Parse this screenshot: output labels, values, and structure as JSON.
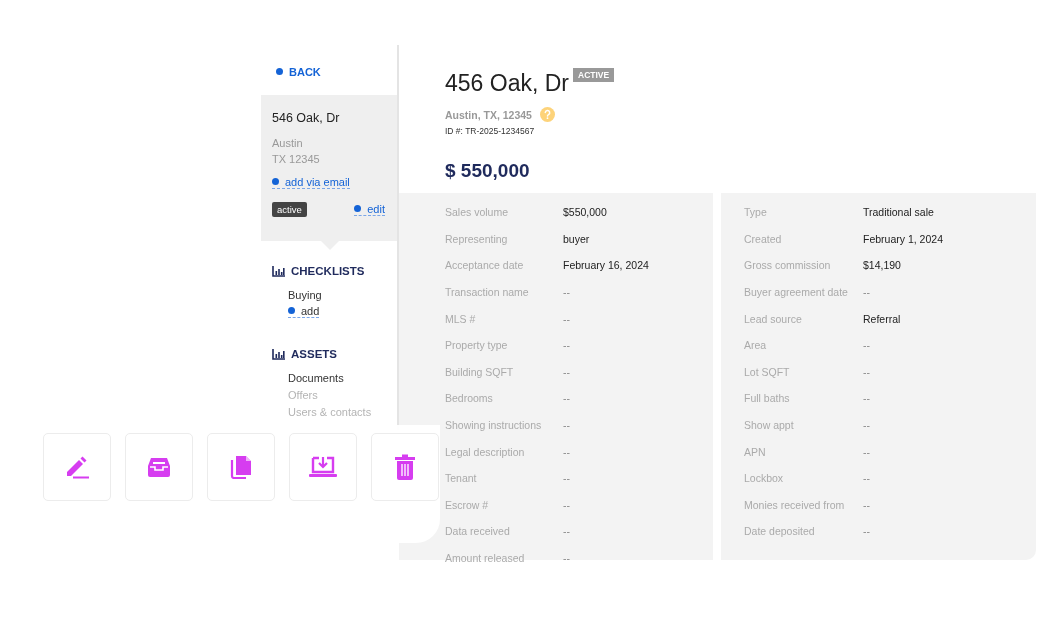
{
  "sidebar": {
    "back": "BACK",
    "card": {
      "title": "546 Oak, Dr",
      "city": "Austin",
      "state_zip": "TX 12345",
      "add_link": "add via email",
      "status": "active",
      "edit_link": "edit"
    },
    "sections": [
      {
        "heading": "CHECKLISTS",
        "items": [
          {
            "kind": "item",
            "label": "Buying",
            "dimmed": false
          },
          {
            "kind": "link",
            "label": "add",
            "dimmed": false
          }
        ]
      },
      {
        "heading": "ASSETS",
        "items": [
          {
            "kind": "item",
            "label": "Documents",
            "dimmed": false
          },
          {
            "kind": "item",
            "label": "Offers",
            "dimmed": true
          },
          {
            "kind": "item",
            "label": "Users & contacts",
            "dimmed": true
          }
        ]
      }
    ]
  },
  "header": {
    "title": "456 Oak, Dr",
    "status": "ACTIVE",
    "location": "Austin, TX, 12345",
    "id": "ID #: TR-2025-1234567",
    "price": "$ 550,000"
  },
  "details_left": [
    {
      "label": "Sales volume",
      "value": "$550,000",
      "muted": false
    },
    {
      "label": "Representing",
      "value": "buyer",
      "muted": false
    },
    {
      "label": "Acceptance date",
      "value": "February 16, 2024",
      "muted": false
    },
    {
      "label": "Transaction name",
      "value": "--",
      "muted": true
    },
    {
      "label": "MLS #",
      "value": "--",
      "muted": true
    },
    {
      "label": "Property type",
      "value": "--",
      "muted": true
    },
    {
      "label": "Building SQFT",
      "value": "--",
      "muted": true
    },
    {
      "label": "Bedrooms",
      "value": "--",
      "muted": true
    },
    {
      "label": "Showing instructions",
      "value": "--",
      "muted": true
    },
    {
      "label": "Legal description",
      "value": "--",
      "muted": true
    },
    {
      "label": "Tenant",
      "value": "--",
      "muted": true
    },
    {
      "label": "Escrow #",
      "value": "--",
      "muted": true
    },
    {
      "label": "Data received",
      "value": "--",
      "muted": true
    },
    {
      "label": "Amount released",
      "value": "--",
      "muted": true
    }
  ],
  "details_right": [
    {
      "label": "Type",
      "value": "Traditional sale",
      "muted": false
    },
    {
      "label": "Created",
      "value": "February 1, 2024",
      "muted": false
    },
    {
      "label": "Gross commission",
      "value": "$14,190",
      "muted": false
    },
    {
      "label": "Buyer agreement date",
      "value": "--",
      "muted": true
    },
    {
      "label": "Lead source",
      "value": "Referral",
      "muted": false
    },
    {
      "label": "Area",
      "value": "--",
      "muted": true
    },
    {
      "label": "Lot SQFT",
      "value": "--",
      "muted": true
    },
    {
      "label": "Full baths",
      "value": "--",
      "muted": true
    },
    {
      "label": "Show appt",
      "value": "--",
      "muted": true
    },
    {
      "label": "APN",
      "value": "--",
      "muted": true
    },
    {
      "label": "Lockbox",
      "value": "--",
      "muted": true
    },
    {
      "label": "Monies received from",
      "value": "--",
      "muted": true
    },
    {
      "label": "Date deposited",
      "value": "--",
      "muted": true
    }
  ],
  "toolbar": [
    {
      "kind": "edit"
    },
    {
      "kind": "archive"
    },
    {
      "kind": "copy"
    },
    {
      "kind": "download"
    },
    {
      "kind": "delete"
    }
  ]
}
